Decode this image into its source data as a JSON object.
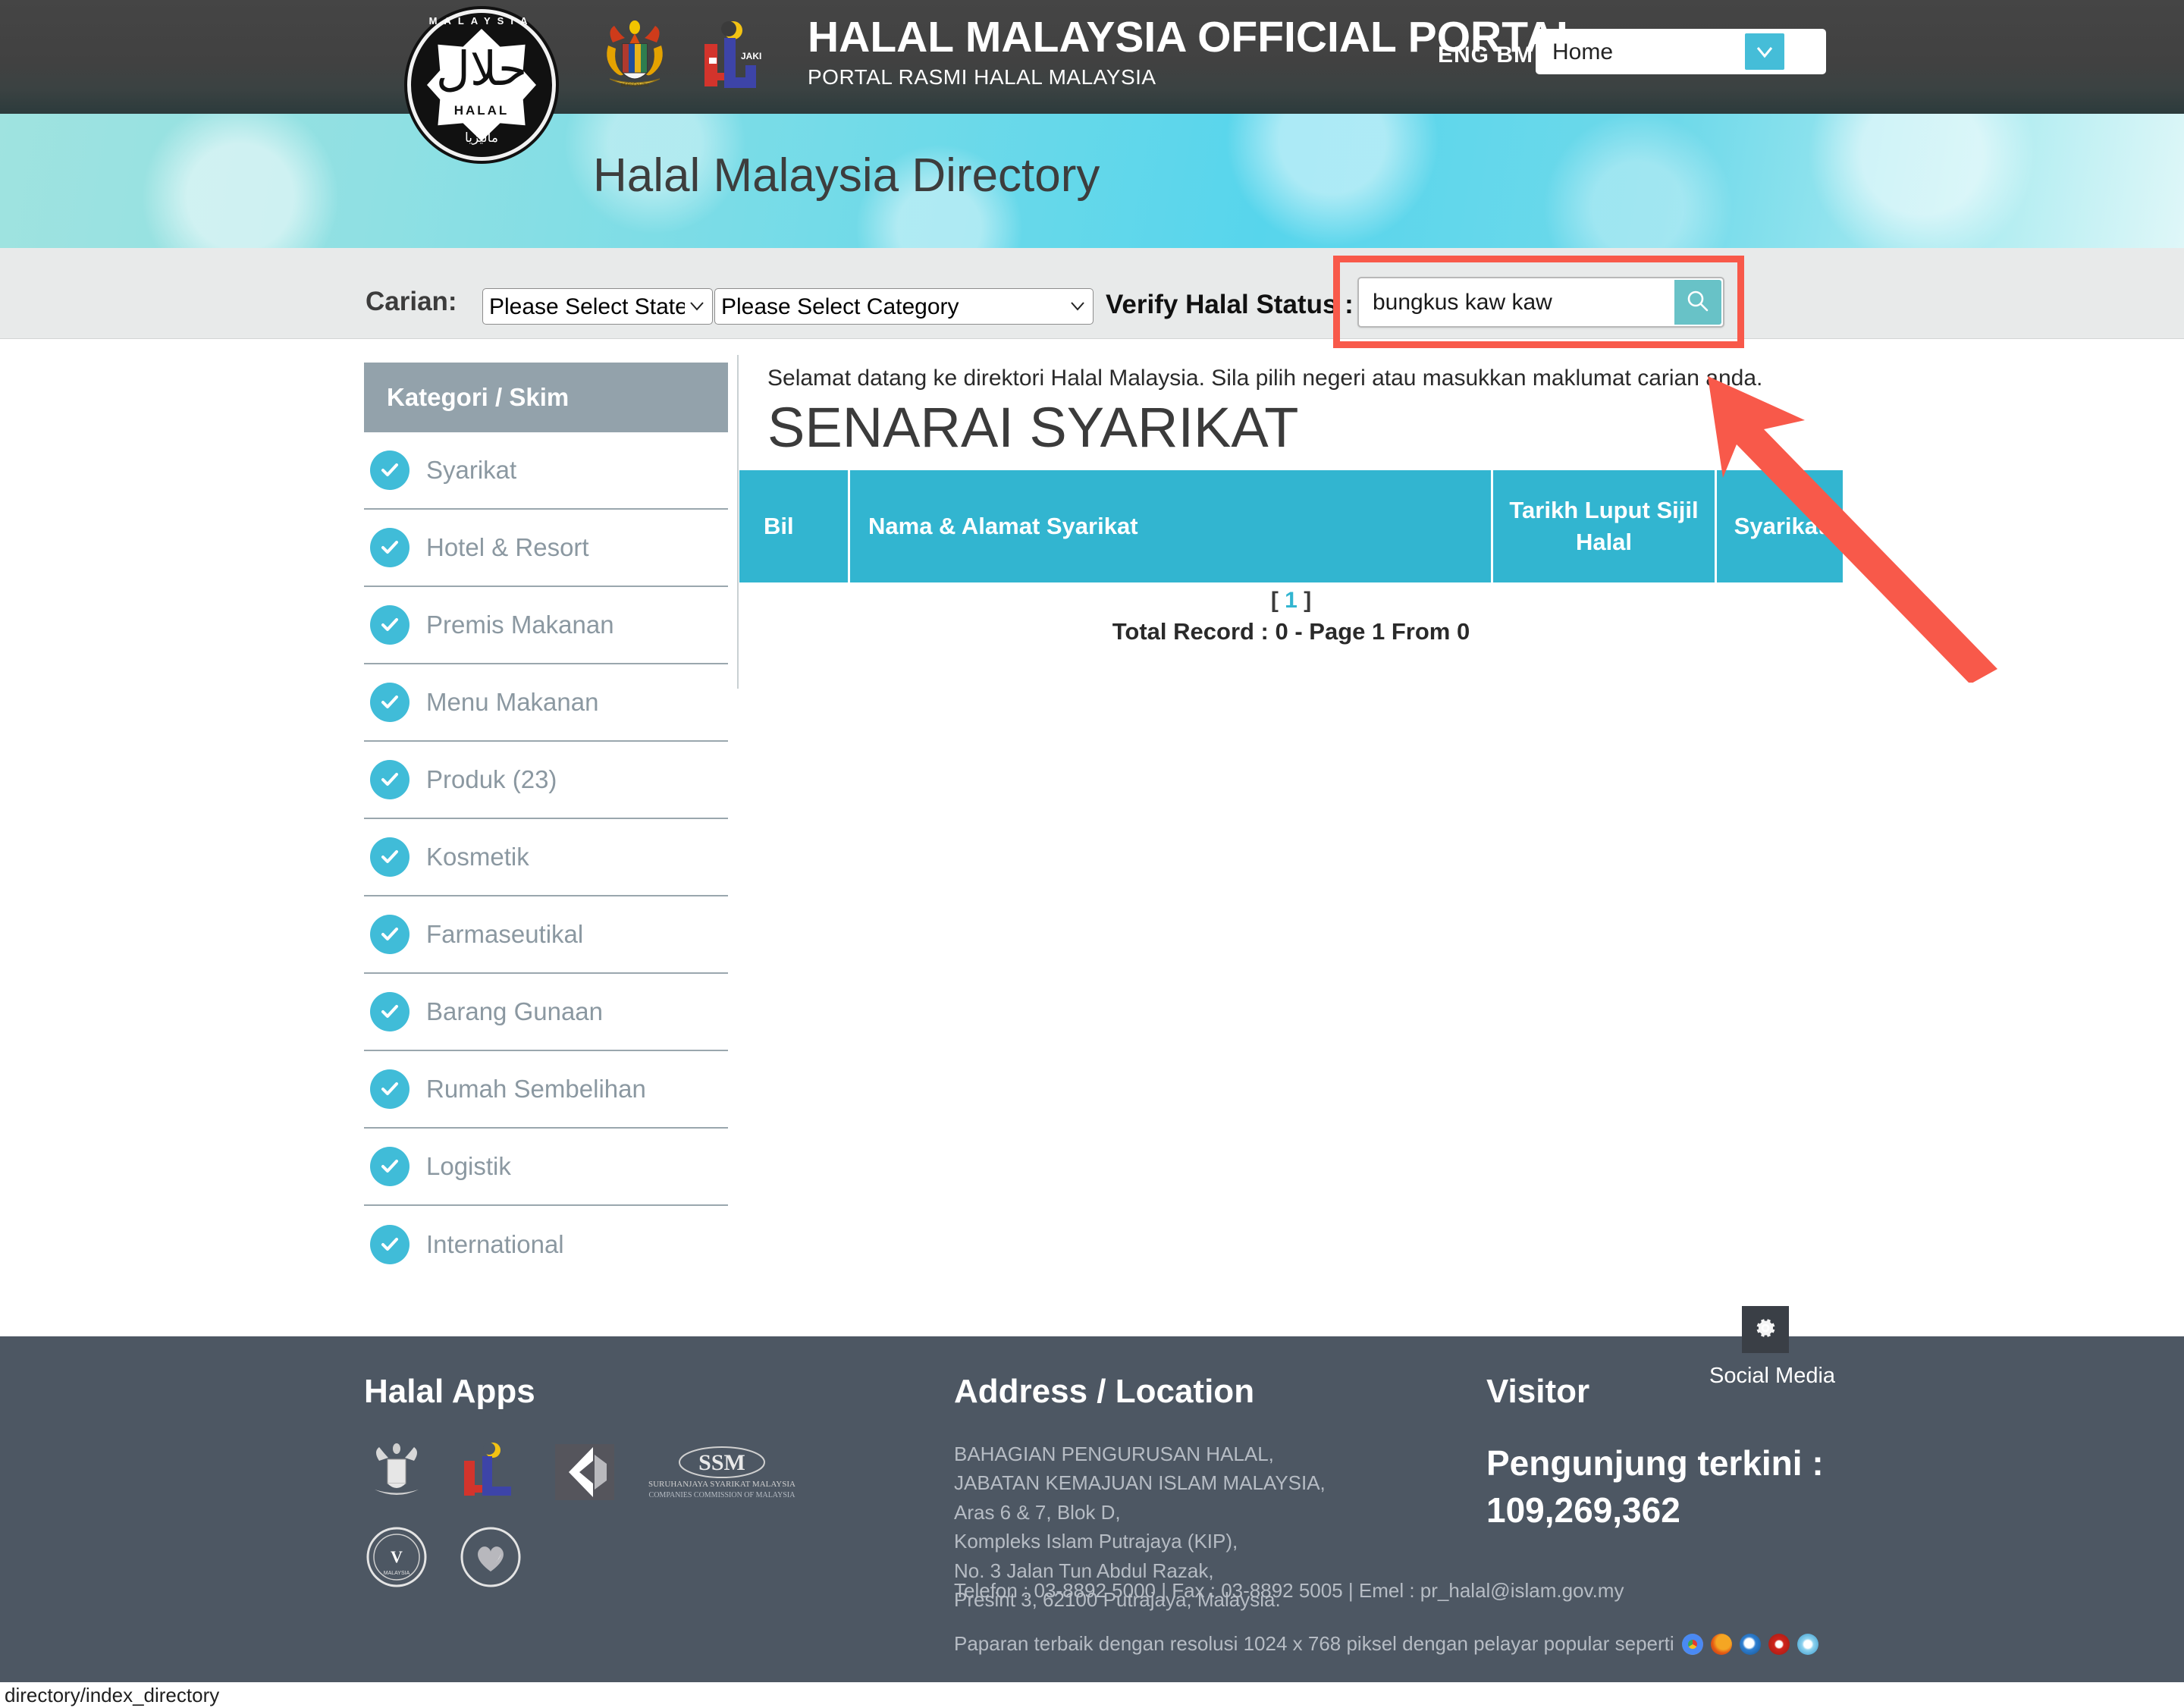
{
  "header": {
    "portal_title": "HALAL MALAYSIA OFFICIAL PORTAL",
    "portal_subtitle": "PORTAL RASMI HALAL MALAYSIA",
    "lang_eng": "ENG",
    "lang_bm": "BM",
    "nav_selected": "Home",
    "nav_options": [
      "Home"
    ],
    "logo_halal_top": "MALAYSIA",
    "logo_halal_word": "HALAL",
    "logo_halal_arabic": "حلال",
    "logo_halal_bottom": "ماليزيا",
    "jakim_label": "JAKIM"
  },
  "banner": {
    "title": "Halal Malaysia Directory"
  },
  "search": {
    "carian_label": "Carian:",
    "state_selected": "Please Select State",
    "state_options": [
      "Please Select State"
    ],
    "category_selected": "Please Select Category",
    "category_options": [
      "Please Select Category"
    ],
    "verify_label": "Verify Halal Status :",
    "query_value": "bungkus kaw kaw",
    "query_placeholder": "",
    "search_icon": "search-icon",
    "highlight_color": "#f8594a"
  },
  "sidebar": {
    "heading": "Kategori / Skim",
    "items": [
      {
        "label": "Syarikat"
      },
      {
        "label": "Hotel & Resort"
      },
      {
        "label": "Premis Makanan"
      },
      {
        "label": "Menu Makanan"
      },
      {
        "label": "Produk (23)"
      },
      {
        "label": "Kosmetik"
      },
      {
        "label": "Farmaseutikal"
      },
      {
        "label": "Barang Gunaan"
      },
      {
        "label": "Rumah Sembelihan"
      },
      {
        "label": "Logistik"
      },
      {
        "label": "International"
      }
    ]
  },
  "main": {
    "welcome": "Selamat datang ke direktori Halal Malaysia. Sila pilih negeri atau masukkan maklumat carian anda.",
    "page_heading": "SENARAI SYARIKAT",
    "table_headers": {
      "bil": "Bil",
      "nama": "Nama & Alamat Syarikat",
      "tarikh": "Tarikh Luput Sijil Halal",
      "syarikat": "Syarikat"
    },
    "rows": [],
    "pager_open": "[",
    "pager_page": "1",
    "pager_close": "]",
    "total_record": "Total Record : 0 - Page 1 From 0",
    "accent_color": "#32b5d0"
  },
  "footer": {
    "apps_title": "Halal Apps",
    "address_title": "Address / Location",
    "address_lines": [
      "BAHAGIAN PENGURUSAN HALAL,",
      "JABATAN KEMAJUAN ISLAM MALAYSIA,",
      "Aras 6 & 7, Blok D,",
      "Kompleks Islam Putrajaya (KIP),",
      "No. 3 Jalan Tun Abdul Razak,",
      "Presint 3, 62100 Putrajaya, Malaysia."
    ],
    "contact_line": "Telefon : 03-8892 5000 | Fax : 03-8892 5005 | Emel : pr_halal@islam.gov.my",
    "browser_line": "Paparan terbaik dengan resolusi 1024 x 768 piksel dengan pelayar popular seperti",
    "visitor_title": "Visitor",
    "visitor_label": "Pengunjung terkini :",
    "visitor_count": "109,269,362",
    "social_label": "Social Media",
    "ssm_line1": "SURUHANJAYA SYARIKAT MALAYSIA",
    "ssm_line2": "COMPANIES COMMISSION OF MALAYSIA",
    "bg_color": "#4d5763"
  },
  "statusbar": {
    "url": "directory/index_directory"
  }
}
